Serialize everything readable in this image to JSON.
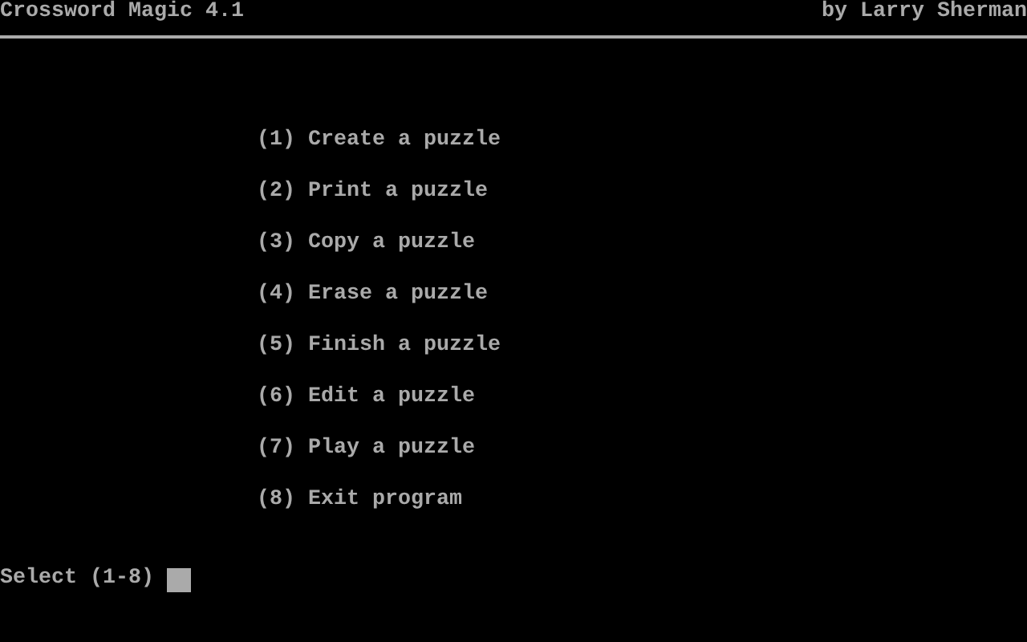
{
  "header": {
    "title": "Crossword Magic 4.1",
    "author": "by Larry Sherman"
  },
  "menu": [
    {
      "label": "(1) Create a puzzle"
    },
    {
      "label": "(2) Print a puzzle"
    },
    {
      "label": "(3) Copy a puzzle"
    },
    {
      "label": "(4) Erase a puzzle"
    },
    {
      "label": "(5) Finish a puzzle"
    },
    {
      "label": "(6) Edit a puzzle"
    },
    {
      "label": "(7) Play a puzzle"
    },
    {
      "label": "(8) Exit program"
    }
  ],
  "prompt": {
    "text": "Select (1-8)"
  }
}
